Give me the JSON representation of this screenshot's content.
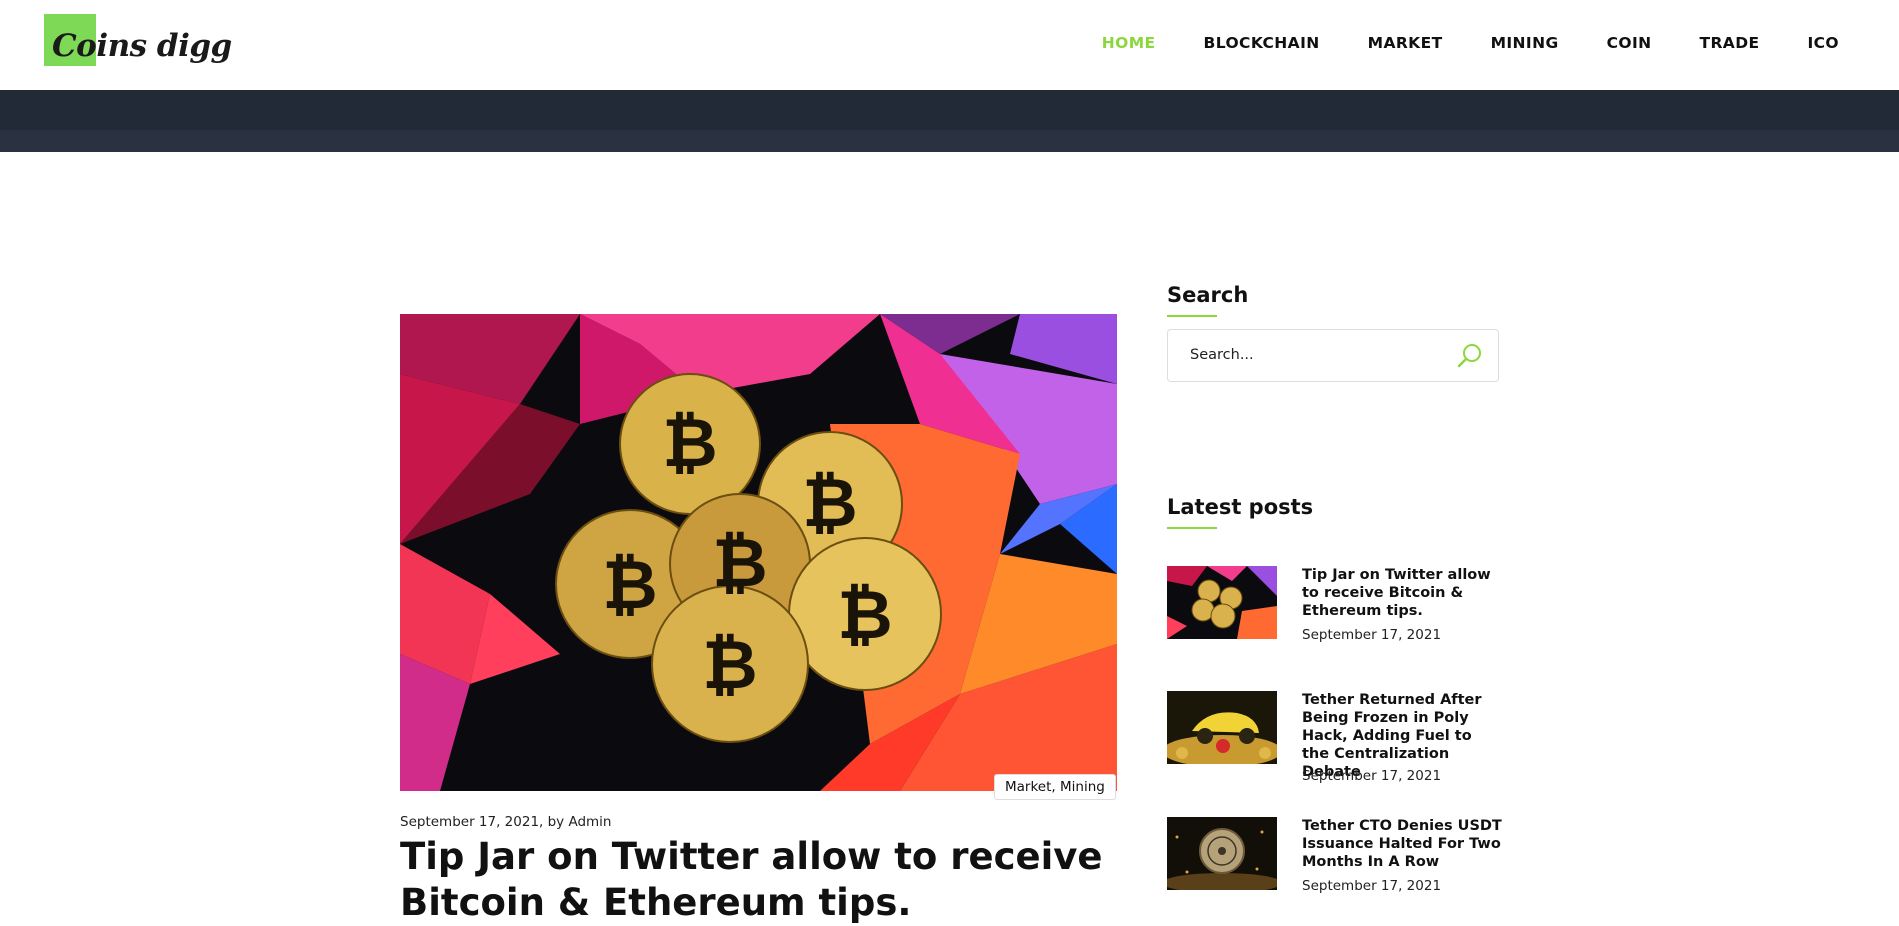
{
  "brand": {
    "logo_text": "Coins digg"
  },
  "nav": {
    "items": [
      {
        "label": "HOME",
        "active": true
      },
      {
        "label": "BLOCKCHAIN",
        "active": false
      },
      {
        "label": "MARKET",
        "active": false
      },
      {
        "label": "MINING",
        "active": false
      },
      {
        "label": "COIN",
        "active": false
      },
      {
        "label": "TRADE",
        "active": false
      },
      {
        "label": "ICO",
        "active": false
      }
    ]
  },
  "colors": {
    "accent": "#8cd73c",
    "logo_green": "#7ed957",
    "band": "#232a37"
  },
  "article": {
    "categories": "Market, Mining",
    "meta": "September 17, 2021, by Admin",
    "title": "Tip Jar on Twitter allow to receive Bitcoin & Ethereum tips."
  },
  "sidebar": {
    "search": {
      "heading": "Search",
      "placeholder": "Search..."
    },
    "latest": {
      "heading": "Latest posts",
      "posts": [
        {
          "title": "Tip Jar on Twitter allow to receive Bitcoin & Ethereum tips.",
          "date": "September 17, 2021"
        },
        {
          "title": "Tether Returned After Being Frozen in Poly Hack, Adding Fuel to the Centralization Debate",
          "date": "September 17, 2021"
        },
        {
          "title": "Tether CTO Denies USDT Issuance Halted For Two Months In A Row",
          "date": "September 17, 2021"
        }
      ]
    }
  },
  "icons": {
    "search": "search-icon"
  }
}
